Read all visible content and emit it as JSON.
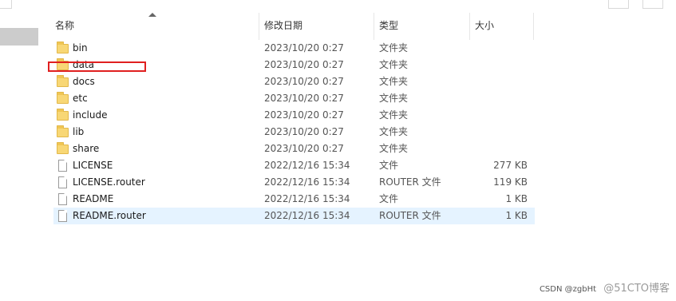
{
  "columns": {
    "name": "名称",
    "date": "修改日期",
    "type": "类型",
    "size": "大小"
  },
  "files": [
    {
      "kind": "folder",
      "name": "bin",
      "date": "2023/10/20 0:27",
      "type": "文件夹",
      "size": ""
    },
    {
      "kind": "folder",
      "name": "data",
      "date": "2023/10/20 0:27",
      "type": "文件夹",
      "size": ""
    },
    {
      "kind": "folder",
      "name": "docs",
      "date": "2023/10/20 0:27",
      "type": "文件夹",
      "size": ""
    },
    {
      "kind": "folder",
      "name": "etc",
      "date": "2023/10/20 0:27",
      "type": "文件夹",
      "size": ""
    },
    {
      "kind": "folder",
      "name": "include",
      "date": "2023/10/20 0:27",
      "type": "文件夹",
      "size": ""
    },
    {
      "kind": "folder",
      "name": "lib",
      "date": "2023/10/20 0:27",
      "type": "文件夹",
      "size": ""
    },
    {
      "kind": "folder",
      "name": "share",
      "date": "2023/10/20 0:27",
      "type": "文件夹",
      "size": ""
    },
    {
      "kind": "file",
      "name": "LICENSE",
      "date": "2022/12/16 15:34",
      "type": "文件",
      "size": "277 KB"
    },
    {
      "kind": "file",
      "name": "LICENSE.router",
      "date": "2022/12/16 15:34",
      "type": "ROUTER 文件",
      "size": "119 KB"
    },
    {
      "kind": "file",
      "name": "README",
      "date": "2022/12/16 15:34",
      "type": "文件",
      "size": "1 KB"
    },
    {
      "kind": "file",
      "name": "README.router",
      "date": "2022/12/16 15:34",
      "type": "ROUTER 文件",
      "size": "1 KB",
      "selected": true
    }
  ],
  "watermark": {
    "text": "CSDN @zgbHt",
    "logo": "@51CTO博客"
  },
  "colors": {
    "highlight": "#e02020",
    "selection": "#e5f3ff",
    "folder": "#f8d775"
  }
}
